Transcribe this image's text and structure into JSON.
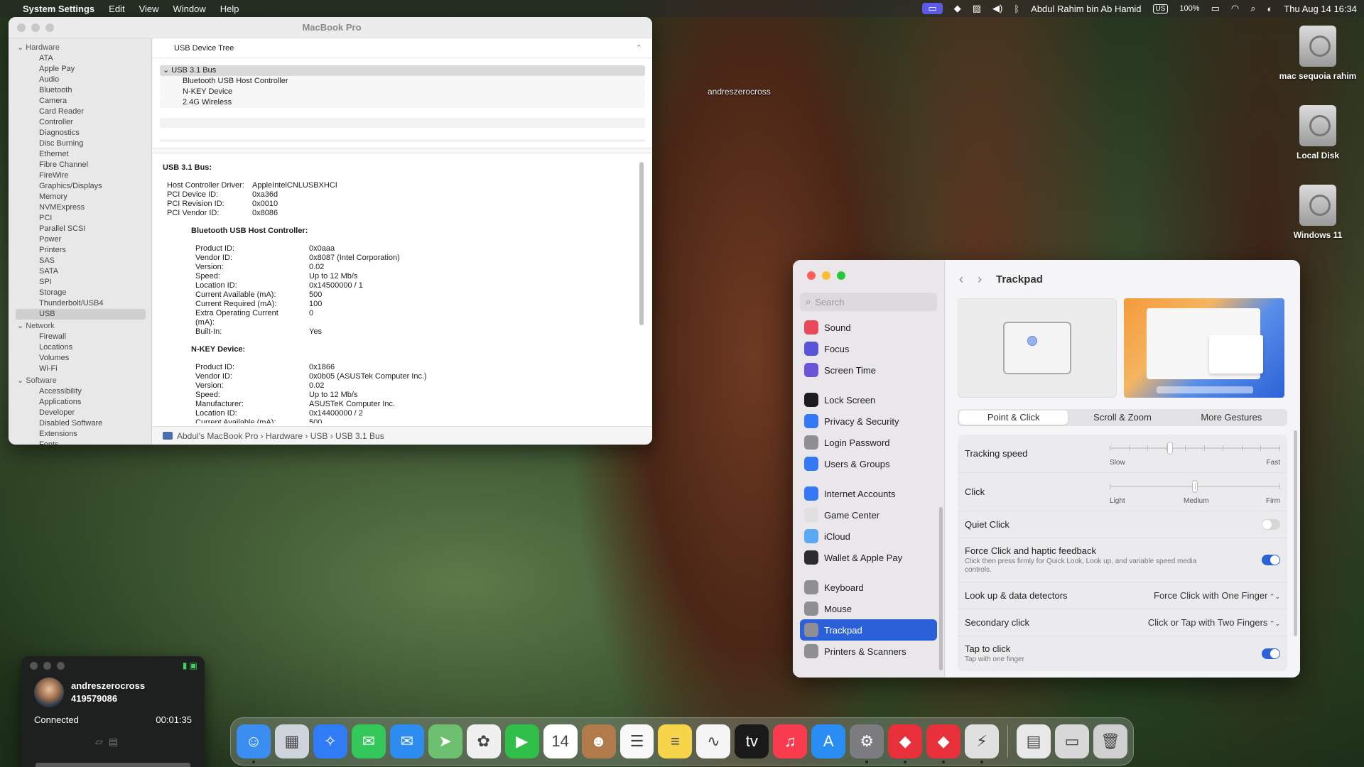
{
  "menubar": {
    "app": "System Settings",
    "menus": [
      "Edit",
      "View",
      "Window",
      "Help"
    ],
    "user": "Abdul Rahim bin Ab Hamid",
    "input_source": "US",
    "battery": "100%",
    "datetime": "Thu Aug 14  16:34"
  },
  "desktop": {
    "cursor_label": "andreszerocross",
    "disks": [
      "mac sequoia rahim",
      "Local Disk",
      "Windows 11"
    ]
  },
  "sysinfo": {
    "title": "MacBook Pro",
    "sidebar": [
      {
        "group": "Hardware",
        "items": [
          "ATA",
          "Apple Pay",
          "Audio",
          "Bluetooth",
          "Camera",
          "Card Reader",
          "Controller",
          "Diagnostics",
          "Disc Burning",
          "Ethernet",
          "Fibre Channel",
          "FireWire",
          "Graphics/Displays",
          "Memory",
          "NVMExpress",
          "PCI",
          "Parallel SCSI",
          "Power",
          "Printers",
          "SAS",
          "SATA",
          "SPI",
          "Storage",
          "Thunderbolt/USB4",
          "USB"
        ]
      },
      {
        "group": "Network",
        "items": [
          "Firewall",
          "Locations",
          "Volumes",
          "Wi-Fi"
        ]
      },
      {
        "group": "Software",
        "items": [
          "Accessibility",
          "Applications",
          "Developer",
          "Disabled Software",
          "Extensions",
          "Fonts"
        ]
      }
    ],
    "selected_item": "USB",
    "tree_header": "USB Device Tree",
    "tree": {
      "bus": "USB 3.1 Bus",
      "children": [
        "Bluetooth USB Host Controller",
        "N-KEY Device",
        "2.4G Wireless"
      ]
    },
    "detail": {
      "heading": "USB 3.1 Bus:",
      "bus_props": [
        [
          "Host Controller Driver:",
          "AppleIntelCNLUSBXHCI"
        ],
        [
          "PCI Device ID:",
          "0xa36d"
        ],
        [
          "PCI Revision ID:",
          "0x0010"
        ],
        [
          "PCI Vendor ID:",
          "0x8086"
        ]
      ],
      "devices": [
        {
          "name": "Bluetooth USB Host Controller:",
          "props": [
            [
              "Product ID:",
              "0x0aaa"
            ],
            [
              "Vendor ID:",
              "0x8087  (Intel Corporation)"
            ],
            [
              "Version:",
              "0.02"
            ],
            [
              "Speed:",
              "Up to 12 Mb/s"
            ],
            [
              "Location ID:",
              "0x14500000 / 1"
            ],
            [
              "Current Available (mA):",
              "500"
            ],
            [
              "Current Required (mA):",
              "100"
            ],
            [
              "Extra Operating Current (mA):",
              "0"
            ],
            [
              "Built-In:",
              "Yes"
            ]
          ]
        },
        {
          "name": "N-KEY Device:",
          "props": [
            [
              "Product ID:",
              "0x1866"
            ],
            [
              "Vendor ID:",
              "0x0b05  (ASUSTek Computer Inc.)"
            ],
            [
              "Version:",
              "0.02"
            ],
            [
              "Speed:",
              "Up to 12 Mb/s"
            ],
            [
              "Manufacturer:",
              "ASUSTeK Computer Inc."
            ],
            [
              "Location ID:",
              "0x14400000 / 2"
            ],
            [
              "Current Available (mA):",
              "500"
            ]
          ]
        }
      ]
    },
    "path": "Abdul's MacBook Pro › Hardware › USB › USB 3.1 Bus"
  },
  "settings": {
    "search_placeholder": "Search",
    "nav": [
      {
        "label": "Sound",
        "color": "#e8485a",
        "icon": "speaker-icon"
      },
      {
        "label": "Focus",
        "color": "#5856d6",
        "icon": "moon-icon"
      },
      {
        "label": "Screen Time",
        "color": "#6a55d8",
        "icon": "hourglass-icon"
      },
      {
        "gap": true
      },
      {
        "label": "Lock Screen",
        "color": "#1c1c1e",
        "icon": "lock-icon"
      },
      {
        "label": "Privacy & Security",
        "color": "#3478f6",
        "icon": "hand-icon"
      },
      {
        "label": "Login Password",
        "color": "#8e8e93",
        "icon": "lock-icon"
      },
      {
        "label": "Users & Groups",
        "color": "#3478f6",
        "icon": "users-icon"
      },
      {
        "gap": true
      },
      {
        "label": "Internet Accounts",
        "color": "#3478f6",
        "icon": "at-icon"
      },
      {
        "label": "Game Center",
        "color": "#e0e0e0",
        "icon": "game-center-icon"
      },
      {
        "label": "iCloud",
        "color": "#5aa9f5",
        "icon": "cloud-icon"
      },
      {
        "label": "Wallet & Apple Pay",
        "color": "#2c2c2e",
        "icon": "wallet-icon"
      },
      {
        "gap": true
      },
      {
        "label": "Keyboard",
        "color": "#8e8e93",
        "icon": "keyboard-icon"
      },
      {
        "label": "Mouse",
        "color": "#8e8e93",
        "icon": "mouse-icon"
      },
      {
        "label": "Trackpad",
        "color": "#8e8e93",
        "icon": "trackpad-icon",
        "selected": true
      },
      {
        "label": "Printers & Scanners",
        "color": "#8e8e93",
        "icon": "printer-icon"
      }
    ],
    "page_title": "Trackpad",
    "tabs": [
      "Point & Click",
      "Scroll & Zoom",
      "More Gestures"
    ],
    "selected_tab": "Point & Click",
    "tracking_speed": {
      "label": "Tracking speed",
      "min": "Slow",
      "max": "Fast",
      "value": 0.35
    },
    "click": {
      "label": "Click",
      "min": "Light",
      "mid": "Medium",
      "max": "Firm",
      "value": 0.5
    },
    "quiet_click": {
      "label": "Quiet Click",
      "on": false
    },
    "force_click": {
      "label": "Force Click and haptic feedback",
      "desc": "Click then press firmly for Quick Look, Look up, and variable speed media controls.",
      "on": true
    },
    "lookup": {
      "label": "Look up & data detectors",
      "value": "Force Click with One Finger"
    },
    "secondary": {
      "label": "Secondary click",
      "value": "Click or Tap with Two Fingers"
    },
    "tap_to_click": {
      "label": "Tap to click",
      "desc": "Tap with one finger",
      "on": true
    }
  },
  "call": {
    "name": "andreszerocross",
    "id": "419579086",
    "status": "Connected",
    "duration": "00:01:35"
  },
  "dock": [
    {
      "name": "finder-icon",
      "color": "#3a8ef0",
      "glyph": "☺",
      "running": true
    },
    {
      "name": "launchpad-icon",
      "color": "#cfd4dc",
      "glyph": "▦"
    },
    {
      "name": "safari-icon",
      "color": "#2f7cf6",
      "glyph": "✧"
    },
    {
      "name": "messages-icon",
      "color": "#34c759",
      "glyph": "✉"
    },
    {
      "name": "mail-icon",
      "color": "#2d8cf0",
      "glyph": "✉"
    },
    {
      "name": "maps-icon",
      "color": "#6cc070",
      "glyph": "➤"
    },
    {
      "name": "photos-icon",
      "color": "#f0f0f0",
      "glyph": "✿"
    },
    {
      "name": "facetime-icon",
      "color": "#30c04a",
      "glyph": "▶"
    },
    {
      "name": "calendar-icon",
      "color": "#ffffff",
      "glyph": "14"
    },
    {
      "name": "contacts-icon",
      "color": "#b07a4a",
      "glyph": "☻"
    },
    {
      "name": "reminders-icon",
      "color": "#f8f8f8",
      "glyph": "☰"
    },
    {
      "name": "notes-icon",
      "color": "#f7d54a",
      "glyph": "≡"
    },
    {
      "name": "freeform-icon",
      "color": "#f5f5f5",
      "glyph": "∿"
    },
    {
      "name": "tv-icon",
      "color": "#1a1a1a",
      "glyph": "tv"
    },
    {
      "name": "music-icon",
      "color": "#f83c4e",
      "glyph": "♫"
    },
    {
      "name": "app-store-icon",
      "color": "#2a8df3",
      "glyph": "A"
    },
    {
      "name": "system-settings-icon",
      "color": "#7b7b80",
      "glyph": "⚙",
      "running": true
    },
    {
      "name": "anydesk-icon",
      "color": "#e8303a",
      "glyph": "◆",
      "running": true
    },
    {
      "name": "anydesk-alt-icon",
      "color": "#e8303a",
      "glyph": "◆",
      "running": true
    },
    {
      "name": "system-information-icon",
      "color": "#e0e0e0",
      "glyph": "⚡",
      "running": true
    },
    {
      "sep": true
    },
    {
      "name": "document-icon",
      "color": "#e8e8e8",
      "glyph": "▤"
    },
    {
      "name": "screenshot-folder-icon",
      "color": "#d8d8d8",
      "glyph": "▭"
    },
    {
      "name": "trash-icon",
      "color": "#d0d0d0",
      "glyph": "🗑"
    }
  ]
}
